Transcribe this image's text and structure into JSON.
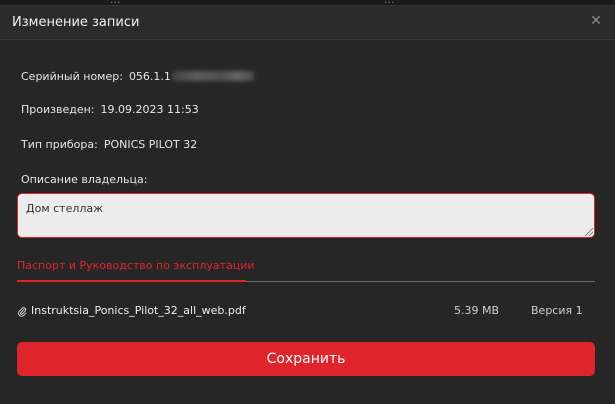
{
  "backdrop": {
    "left_text": "...",
    "right_text": "..."
  },
  "dialog": {
    "title": "Изменение записи",
    "close_icon": "close-icon",
    "fields": {
      "serial_label": "Серийный номер:",
      "serial_value_visible": "056.1.1",
      "produced_label": "Произведен:",
      "produced_value": "19.09.2023 11:53",
      "device_type_label": "Тип прибора:",
      "device_type_value": "PONICS PILOT 32",
      "owner_description_label": "Описание владельца:"
    },
    "description_input": {
      "value": "Дом стеллаж"
    },
    "tab": {
      "label": "Паспорт и Руководство по эксплуатации"
    },
    "file": {
      "icon": "paperclip-icon",
      "name": "Instruktsia_Ponics_Pilot_32_all_web.pdf",
      "size": "5.39 MB",
      "version": "Версия 1"
    },
    "save_button": {
      "label": "Сохранить"
    },
    "colors": {
      "accent": "#e0242b",
      "background": "#262626",
      "text": "#e6e6e6"
    }
  }
}
